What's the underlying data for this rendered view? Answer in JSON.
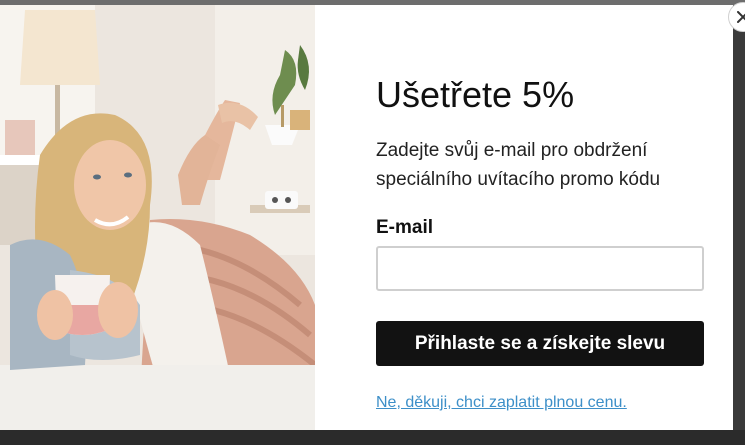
{
  "popup": {
    "title": "Ušetřete 5%",
    "subtitle": "Zadejte svůj e-mail pro obdržení speciálního uvítacího promo kódu",
    "email_label": "E-mail",
    "email_value": "",
    "submit_label": "Přihlaste se a získejte slevu",
    "decline_label": "Ne, děkuji, chci zaplatit plnou cenu."
  },
  "photo": {
    "icon": "woman-with-mug-photo"
  },
  "close": {
    "icon": "close-icon"
  },
  "colors": {
    "button_bg": "#121212",
    "link": "#3d8fc8",
    "input_border": "#cfcfcf"
  }
}
